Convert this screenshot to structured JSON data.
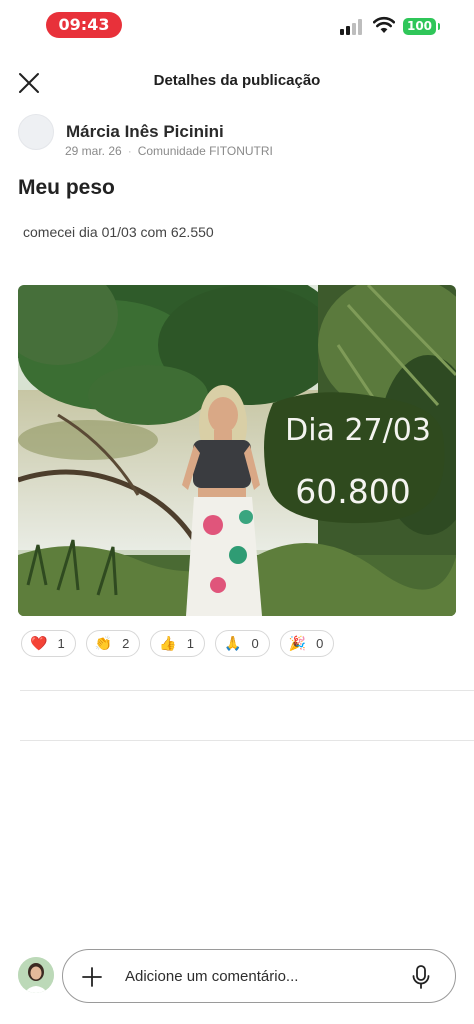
{
  "status_bar": {
    "time": "09:43",
    "battery": "100",
    "time_color": "#e8313a",
    "battery_color": "#2fc659"
  },
  "header": {
    "title": "Detalhes da publicação",
    "close_icon": "close-icon"
  },
  "post": {
    "author_name": "Márcia Inês Picinini",
    "date": "29 mar. 26",
    "community": "Comunidade FITONUTRI",
    "title": "Meu peso",
    "body": "comecei dia 01/03 com 62.550",
    "image": {
      "overlay_line1": "Dia 27/03",
      "overlay_line2": "60.800",
      "overlay_color": "#2f4a1e"
    },
    "reactions": [
      {
        "emoji": "❤️",
        "icon": "heart-icon",
        "count": "1"
      },
      {
        "emoji": "👏",
        "icon": "clapping-hands-icon",
        "count": "2"
      },
      {
        "emoji": "👍",
        "icon": "thumbs-up-icon",
        "count": "1"
      },
      {
        "emoji": "🙏",
        "icon": "folded-hands-icon",
        "count": "0"
      },
      {
        "emoji": "🎉",
        "icon": "party-popper-icon",
        "count": "0"
      }
    ]
  },
  "comment_bar": {
    "placeholder": "Adicione um comentário...",
    "add_icon": "plus-icon",
    "mic_icon": "microphone-icon"
  }
}
